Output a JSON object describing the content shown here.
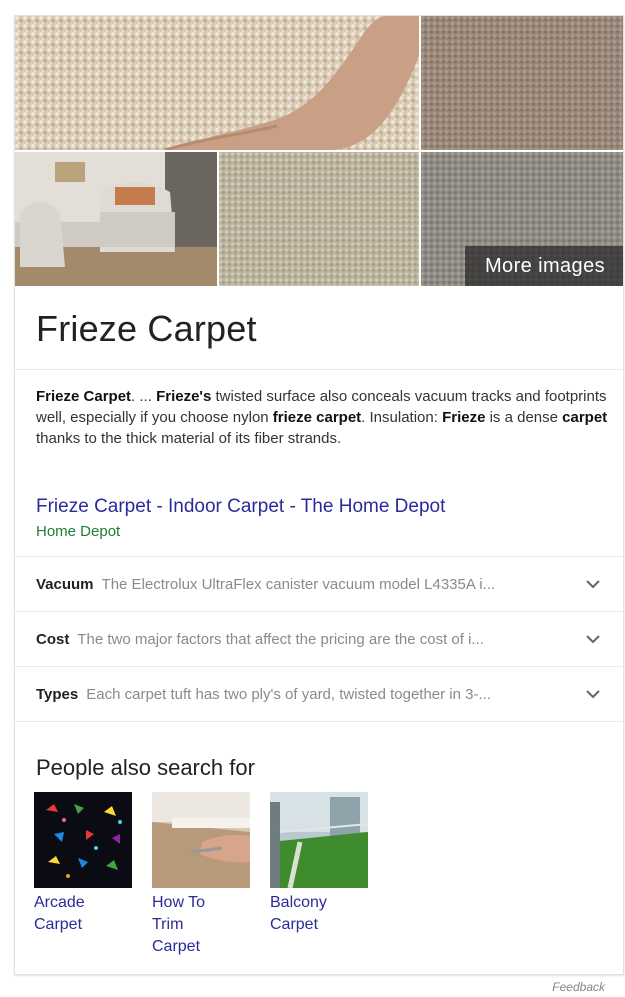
{
  "images": {
    "more_images_label": "More images"
  },
  "title": "Frieze Carpet",
  "description": {
    "segments": [
      {
        "text": "Frieze Carpet",
        "bold": true
      },
      {
        "text": ". ... ",
        "bold": false
      },
      {
        "text": "Frieze's",
        "bold": true
      },
      {
        "text": " twisted surface also conceals vacuum tracks and footprints well, especially if you choose nylon ",
        "bold": false
      },
      {
        "text": "frieze carpet",
        "bold": true
      },
      {
        "text": ". Insulation: ",
        "bold": false
      },
      {
        "text": "Frieze",
        "bold": true
      },
      {
        "text": " is a dense ",
        "bold": false
      },
      {
        "text": "carpet",
        "bold": true
      },
      {
        "text": " thanks to the thick material of its fiber strands.",
        "bold": false
      }
    ]
  },
  "source": {
    "link_text": "Frieze Carpet - Indoor Carpet - The Home Depot",
    "site": "Home Depot"
  },
  "attributes": [
    {
      "key": "Vacuum",
      "value": "The Electrolux UltraFlex canister vacuum model L4335A i..."
    },
    {
      "key": "Cost",
      "value": "The two major factors that affect the pricing are the cost of i..."
    },
    {
      "key": "Types",
      "value": "Each carpet tuft has two ply's of yard, twisted together in 3-..."
    }
  ],
  "people_also_search": {
    "title": "People also search for",
    "items": [
      {
        "label": "Arcade Carpet"
      },
      {
        "label": "How To Trim Carpet"
      },
      {
        "label": "Balcony Carpet"
      }
    ]
  },
  "feedback_label": "Feedback"
}
